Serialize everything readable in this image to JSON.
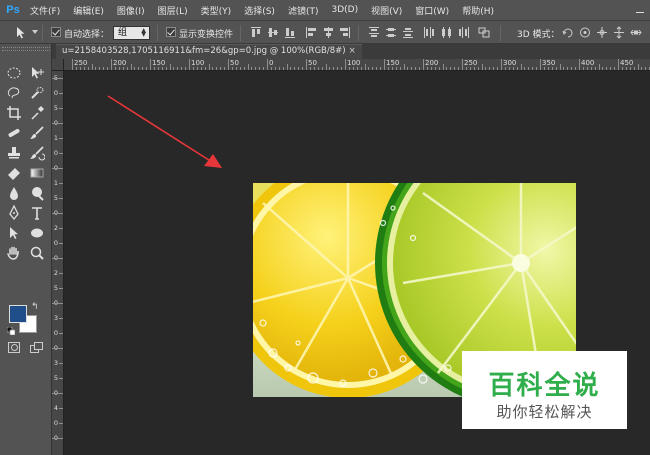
{
  "app": {
    "logo": "Ps"
  },
  "menu": {
    "items": [
      "文件(F)",
      "编辑(E)",
      "图像(I)",
      "图层(L)",
      "类型(Y)",
      "选择(S)",
      "滤镜(T)",
      "3D(D)",
      "视图(V)",
      "窗口(W)",
      "帮助(H)"
    ]
  },
  "options": {
    "auto_select_label": "自动选择：",
    "auto_select_value": "组",
    "show_transform_label": "显示变换控件",
    "mode_3d_label": "3D 模式："
  },
  "document": {
    "tab_title": "u=2158403528,1705116911&fm=26&gp=0.jpg @ 100%(RGB/8#)",
    "tab_close": "×"
  },
  "ruler": {
    "top_labels": [
      "250",
      "200",
      "150",
      "100",
      "50",
      "0",
      "50",
      "100",
      "150",
      "200",
      "250",
      "300",
      "350",
      "400",
      "450",
      "500",
      "550",
      "600",
      "650"
    ],
    "left_labels": [
      "5",
      "0",
      "5",
      "0",
      "1",
      "0",
      "0",
      "1",
      "5",
      "0",
      "2",
      "0",
      "0",
      "2",
      "5",
      "0",
      "3",
      "0",
      "0",
      "3",
      "5",
      "0",
      "4",
      "0",
      "0"
    ]
  },
  "colors": {
    "foreground": "#1f4e8a",
    "background": "#ffffff",
    "accent_ps": "#31a8ff",
    "annotation_arrow": "#e8373a",
    "watermark_green": "#2fae4b"
  },
  "watermark": {
    "title": "百科全说",
    "subtitle": "助你轻松解决"
  },
  "icons": {
    "toolbox": [
      "marquee-icon",
      "move-icon",
      "lasso-icon",
      "quick-select-icon",
      "crop-icon",
      "eyedropper-icon",
      "healing-icon",
      "brush-icon",
      "stamp-icon",
      "history-brush-icon",
      "eraser-icon",
      "gradient-icon",
      "blur-icon",
      "dodge-icon",
      "pen-icon",
      "type-icon",
      "path-select-icon",
      "ellipse-icon",
      "hand-icon",
      "zoom-icon"
    ]
  }
}
